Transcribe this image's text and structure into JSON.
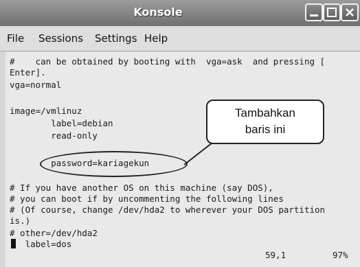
{
  "window": {
    "title": "Konsole"
  },
  "menu": [
    "File",
    "Sessions",
    "Settings",
    "Help"
  ],
  "terminal": {
    "lines": [
      "#    can be obtained by booting with  vga=ask  and pressing [",
      "Enter].",
      "vga=normal",
      "",
      "image=/vmlinuz",
      "        label=debian",
      "        read-only",
      "",
      "        password=kariagekun",
      "",
      "# If you have another OS on this machine (say DOS),",
      "# you can boot if by uncommenting the following lines",
      "# (Of course, change /dev/hda2 to wherever your DOS partition",
      "is.)",
      "# other=/dev/hda2",
      "   label=dos"
    ],
    "position": "59,1",
    "percent": "97%"
  },
  "callout": {
    "line1": "Tambahkan",
    "line2": "baris ini"
  }
}
